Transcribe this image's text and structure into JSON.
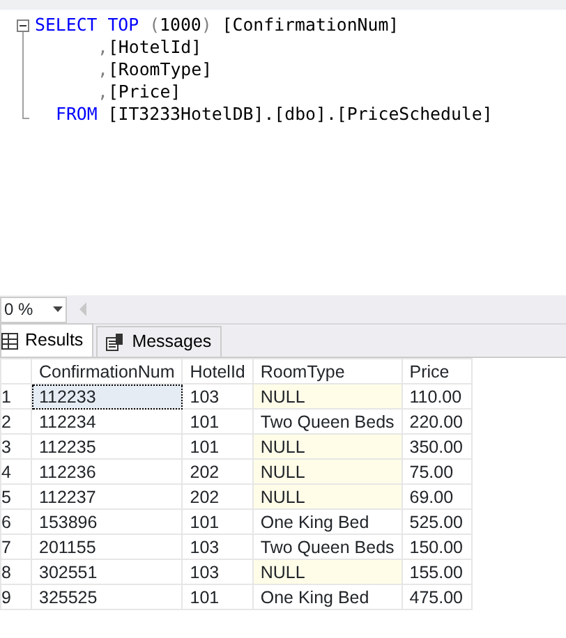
{
  "editor": {
    "lines": [
      {
        "kind": "select",
        "tokens": [
          {
            "kind": "keyword",
            "text": "SELECT"
          },
          {
            "kind": "keyword",
            "text": " TOP"
          },
          {
            "kind": "punct",
            "text": " ("
          },
          {
            "kind": "plain",
            "text": "1000"
          },
          {
            "kind": "punct",
            "text": ")"
          },
          {
            "kind": "plain",
            "text": " [ConfirmationNum]"
          }
        ]
      },
      {
        "kind": "column",
        "tokens": [
          {
            "kind": "punct",
            "text": ","
          },
          {
            "kind": "plain",
            "text": "[HotelId]"
          }
        ]
      },
      {
        "kind": "column",
        "tokens": [
          {
            "kind": "punct",
            "text": ","
          },
          {
            "kind": "plain",
            "text": "[RoomType]"
          }
        ]
      },
      {
        "kind": "column",
        "tokens": [
          {
            "kind": "punct",
            "text": ","
          },
          {
            "kind": "plain",
            "text": "[Price]"
          }
        ]
      },
      {
        "kind": "from",
        "tokens": [
          {
            "kind": "keyword",
            "text": "FROM"
          },
          {
            "kind": "plain",
            "text": " [IT3233HotelDB].[dbo].[PriceSchedule]"
          }
        ]
      }
    ]
  },
  "zoom": {
    "value": "0 %"
  },
  "tabs": [
    {
      "label": "Results",
      "selected": true,
      "kind": "grid"
    },
    {
      "label": "Messages",
      "selected": false,
      "kind": "messages"
    }
  ],
  "table": {
    "columns": [
      "ConfirmationNum",
      "HotelId",
      "RoomType",
      "Price"
    ],
    "rows": [
      {
        "number": "1",
        "selected": true,
        "room_type_null": true,
        "cells": [
          "112233",
          "103",
          "NULL",
          "110.00"
        ]
      },
      {
        "number": "2",
        "selected": false,
        "room_type_null": false,
        "cells": [
          "112234",
          "101",
          "Two Queen Beds",
          "220.00"
        ]
      },
      {
        "number": "3",
        "selected": false,
        "room_type_null": true,
        "cells": [
          "112235",
          "101",
          "NULL",
          "350.00"
        ]
      },
      {
        "number": "4",
        "selected": false,
        "room_type_null": true,
        "cells": [
          "112236",
          "202",
          "NULL",
          "75.00"
        ]
      },
      {
        "number": "5",
        "selected": false,
        "room_type_null": true,
        "cells": [
          "112237",
          "202",
          "NULL",
          "69.00"
        ]
      },
      {
        "number": "6",
        "selected": false,
        "room_type_null": false,
        "cells": [
          "153896",
          "101",
          "One King Bed",
          "525.00"
        ]
      },
      {
        "number": "7",
        "selected": false,
        "room_type_null": false,
        "cells": [
          "201155",
          "103",
          "Two Queen Beds",
          "150.00"
        ]
      },
      {
        "number": "8",
        "selected": false,
        "room_type_null": true,
        "cells": [
          "302551",
          "103",
          "NULL",
          "155.00"
        ]
      },
      {
        "number": "9",
        "selected": false,
        "room_type_null": false,
        "cells": [
          "325525",
          "101",
          "One King Bed",
          "475.00"
        ]
      }
    ]
  }
}
